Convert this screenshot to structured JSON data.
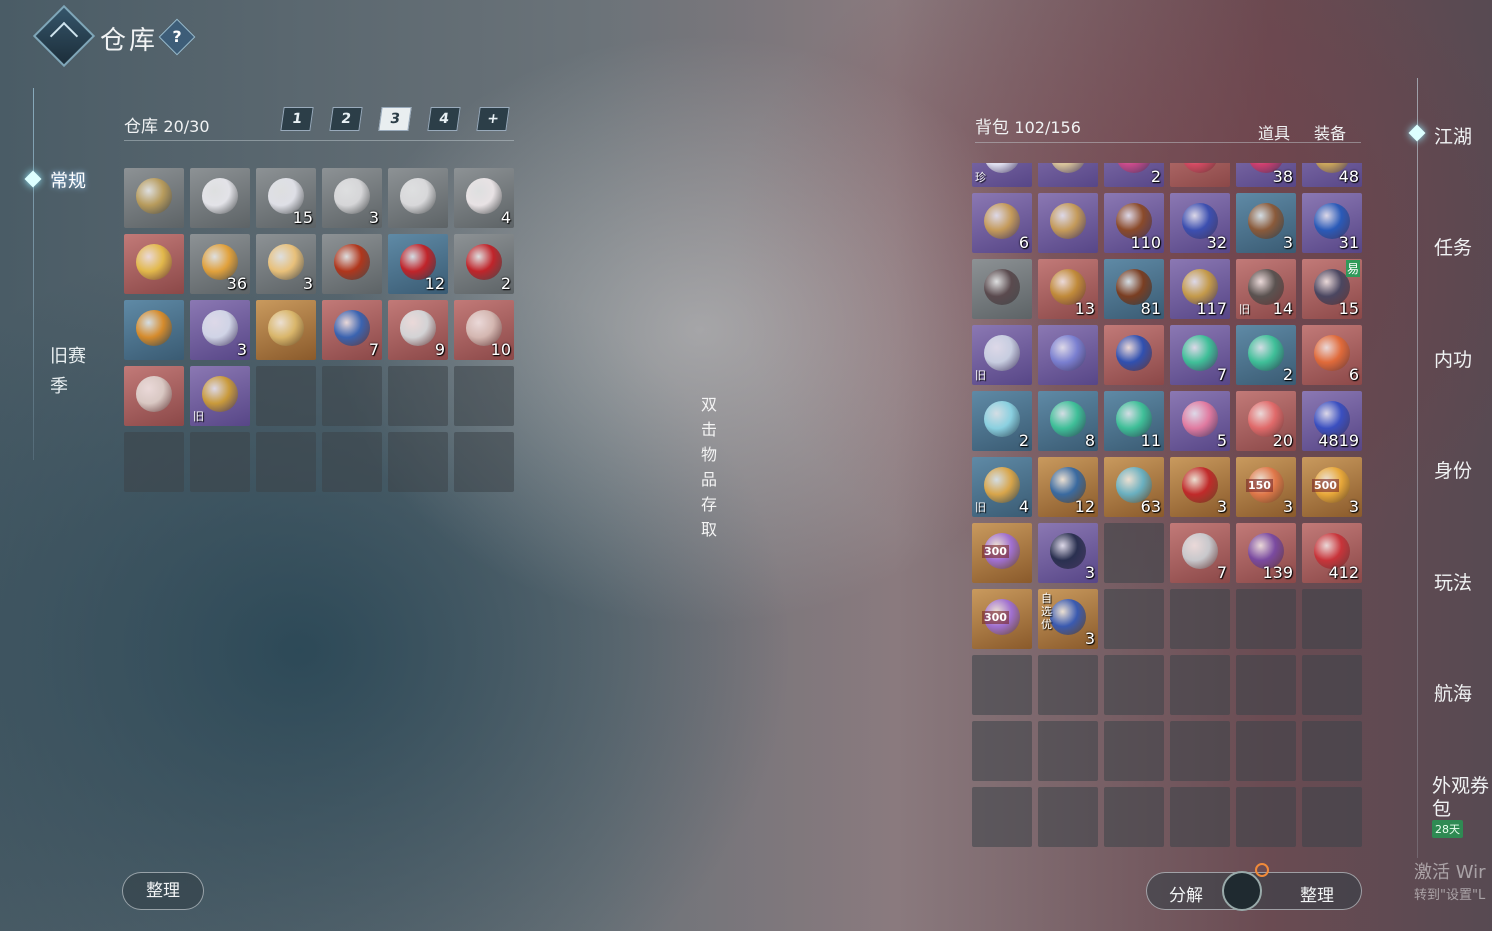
{
  "header": {
    "title": "仓库",
    "help": "?"
  },
  "left_tabs": [
    {
      "label": "常规",
      "active": true
    },
    {
      "label": "旧赛",
      "label2": "季",
      "active": false
    }
  ],
  "warehouse": {
    "label": "仓库",
    "capacity": "20/30",
    "pages": [
      "1",
      "2",
      "3",
      "4",
      "+"
    ],
    "active_page": "3",
    "items": [
      {
        "q": "gray",
        "color": "#b79b5c"
      },
      {
        "q": "gray",
        "color": "#e3e3e8"
      },
      {
        "q": "gray",
        "color": "#dedfe6",
        "n": "15"
      },
      {
        "q": "gray",
        "color": "#d6d6d8",
        "n": "3"
      },
      {
        "q": "gray",
        "color": "#d8d8da"
      },
      {
        "q": "gray",
        "color": "#e8e2e4",
        "n": "4"
      },
      {
        "q": "red",
        "color": "#e2b84b"
      },
      {
        "q": "gray",
        "color": "#e1a13c",
        "n": "36"
      },
      {
        "q": "gray",
        "color": "#e8c07a",
        "n": "3"
      },
      {
        "q": "gray",
        "color": "#b0361c"
      },
      {
        "q": "blue",
        "color": "#c0242a",
        "n": "12"
      },
      {
        "q": "gray",
        "color": "#c0242a",
        "n": "2"
      },
      {
        "q": "blue",
        "color": "#d58b2c"
      },
      {
        "q": "purple",
        "color": "#d0d4e6",
        "n": "3"
      },
      {
        "q": "gold",
        "color": "#d9b66b"
      },
      {
        "q": "red",
        "color": "#3a63b0",
        "n": "7"
      },
      {
        "q": "red",
        "color": "#d3d3d5",
        "n": "9"
      },
      {
        "q": "red",
        "color": "#d4b7b1",
        "n": "10"
      },
      {
        "q": "red",
        "color": "#d9c8c3"
      },
      {
        "q": "purple",
        "color": "#c99a3b",
        "tag": "旧"
      },
      {
        "q": "empty"
      },
      {
        "q": "empty"
      },
      {
        "q": "empty"
      },
      {
        "q": "empty"
      },
      {
        "q": "empty"
      },
      {
        "q": "empty"
      },
      {
        "q": "empty"
      },
      {
        "q": "empty"
      },
      {
        "q": "empty"
      },
      {
        "q": "empty"
      }
    ]
  },
  "hint": [
    "双",
    "击",
    "物",
    "品",
    "存",
    "取"
  ],
  "bag": {
    "label": "背包",
    "capacity": "102/156",
    "filters": [
      "道具",
      "装备"
    ],
    "top_row": [
      {
        "q": "purple",
        "color": "#e0e0f0",
        "tag": "珍"
      },
      {
        "q": "purple",
        "color": "#d8c39a"
      },
      {
        "q": "purple",
        "color": "#c94a8a",
        "n": "2"
      },
      {
        "q": "red",
        "color": "#d34a62"
      },
      {
        "q": "purple",
        "color": "#cf3e6e",
        "n": "38"
      },
      {
        "q": "purple",
        "color": "#c9a45a",
        "n": "48"
      }
    ],
    "items": [
      {
        "q": "purple",
        "color": "#c49a5a",
        "n": "6"
      },
      {
        "q": "purple",
        "color": "#c49a5a"
      },
      {
        "q": "purple",
        "color": "#8a4a2a",
        "n": "110"
      },
      {
        "q": "purple",
        "color": "#3c4fb0",
        "n": "32"
      },
      {
        "q": "blue",
        "color": "#8a5a3a",
        "n": "3"
      },
      {
        "q": "purple",
        "color": "#2a5ab8",
        "n": "31"
      },
      {
        "q": "gray",
        "color": "#5a4a4e"
      },
      {
        "q": "red",
        "color": "#c08a3a",
        "n": "13"
      },
      {
        "q": "blue",
        "color": "#7a3e22",
        "n": "81"
      },
      {
        "q": "purple",
        "color": "#c49a4a",
        "n": "117"
      },
      {
        "q": "red",
        "color": "#5a5250",
        "n": "14",
        "tag": "旧"
      },
      {
        "q": "red",
        "color": "#4a4660",
        "n": "15",
        "tag2": "易"
      },
      {
        "q": "purple",
        "color": "#c7cde0",
        "tag": "旧"
      },
      {
        "q": "purple",
        "color": "#7a7fd0"
      },
      {
        "q": "red",
        "color": "#3050b0"
      },
      {
        "q": "purple",
        "color": "#3fbf98",
        "n": "7"
      },
      {
        "q": "blue",
        "color": "#3fbf98",
        "n": "2"
      },
      {
        "q": "red",
        "color": "#e06a3a",
        "n": "6"
      },
      {
        "q": "blue",
        "color": "#8ad0e0",
        "n": "2"
      },
      {
        "q": "blue",
        "color": "#3fbf98",
        "n": "8"
      },
      {
        "q": "blue",
        "color": "#3fbf98",
        "n": "11"
      },
      {
        "q": "purple",
        "color": "#e07aa0",
        "n": "5"
      },
      {
        "q": "red",
        "color": "#e06a6a",
        "n": "20"
      },
      {
        "q": "purple",
        "color": "#3a4fc0",
        "n": "4819"
      },
      {
        "q": "blue",
        "color": "#d8a54a",
        "n": "4",
        "tag": "旧"
      },
      {
        "q": "gold",
        "color": "#3a6aa0",
        "n": "12"
      },
      {
        "q": "gold",
        "color": "#6ab0c0",
        "n": "63"
      },
      {
        "q": "gold",
        "color": "#c02a2a",
        "n": "3"
      },
      {
        "q": "gold",
        "color": "#e0784a",
        "n": "3",
        "label": "150"
      },
      {
        "q": "gold",
        "color": "#e8a83a",
        "n": "3",
        "label": "500"
      },
      {
        "q": "gold",
        "color": "#a070d0",
        "label": "300"
      },
      {
        "q": "purple",
        "color": "#2a3050",
        "n": "3"
      },
      {
        "q": "empty"
      },
      {
        "q": "red",
        "color": "#c8c8cc",
        "n": "7"
      },
      {
        "q": "red",
        "color": "#7a4aa0",
        "n": "139"
      },
      {
        "q": "red",
        "color": "#c8343a",
        "n": "412"
      },
      {
        "q": "gold",
        "color": "#a070d0",
        "label": "300"
      },
      {
        "q": "gold",
        "color": "#3a5ab0",
        "n": "3",
        "tag3": "自选优"
      },
      {
        "q": "empty"
      },
      {
        "q": "empty"
      },
      {
        "q": "empty"
      },
      {
        "q": "empty"
      },
      {
        "q": "empty"
      },
      {
        "q": "empty"
      },
      {
        "q": "empty"
      },
      {
        "q": "empty"
      },
      {
        "q": "empty"
      },
      {
        "q": "empty"
      },
      {
        "q": "empty"
      },
      {
        "q": "empty"
      },
      {
        "q": "empty"
      },
      {
        "q": "empty"
      },
      {
        "q": "empty"
      },
      {
        "q": "empty"
      },
      {
        "q": "empty"
      },
      {
        "q": "empty"
      },
      {
        "q": "empty"
      },
      {
        "q": "empty"
      },
      {
        "q": "empty"
      },
      {
        "q": "empty"
      }
    ]
  },
  "right_tabs": [
    {
      "label": "江湖",
      "active": true
    },
    {
      "label": "任务"
    },
    {
      "label": "内功"
    },
    {
      "label": "身份"
    },
    {
      "label": "玩法"
    },
    {
      "label": "航海"
    },
    {
      "label": "外观券",
      "label2": "包",
      "badge": "28天"
    }
  ],
  "buttons": {
    "left_sort": "整理",
    "decompose": "分解",
    "right_sort": "整理"
  },
  "os_watermark": {
    "line1": "激活 Wir",
    "line2": "转到\"设置\"L"
  }
}
